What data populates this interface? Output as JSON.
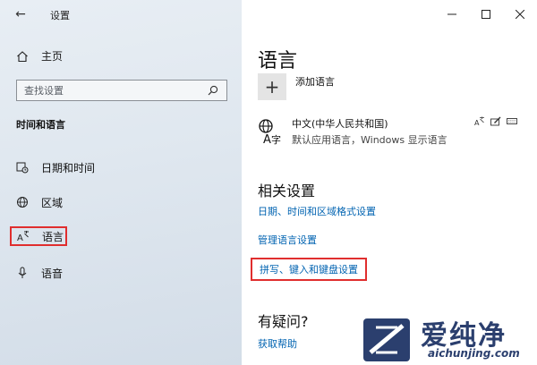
{
  "window": {
    "title": "设置"
  },
  "sidebar": {
    "home_label": "主页",
    "search_placeholder": "查找设置",
    "section_heading": "时间和语言",
    "items": [
      {
        "label": "日期和时间",
        "icon": "calendar-clock-icon"
      },
      {
        "label": "区域",
        "icon": "globe-icon"
      },
      {
        "label": "语言",
        "icon": "language-icon",
        "selected": true
      },
      {
        "label": "语音",
        "icon": "microphone-icon"
      }
    ]
  },
  "main": {
    "title": "语言",
    "add_language_label": "添加语言",
    "language": {
      "name": "中文(中华人民共和国)",
      "description": "默认应用语言，Windows 显示语言"
    },
    "related_heading": "相关设置",
    "related_links": [
      "日期、时间和区域格式设置",
      "管理语言设置",
      "拼写、键入和键盘设置"
    ],
    "help_heading": "有疑问?",
    "help_link": "获取帮助"
  },
  "watermark": {
    "brand_cn": "爱纯净",
    "brand_en": "aichunjing.com"
  },
  "colors": {
    "link": "#0063b1",
    "highlight_box": "#e02e2e",
    "sidebar_bg": "#dfe7ef",
    "brand": "#2b3f6e"
  }
}
